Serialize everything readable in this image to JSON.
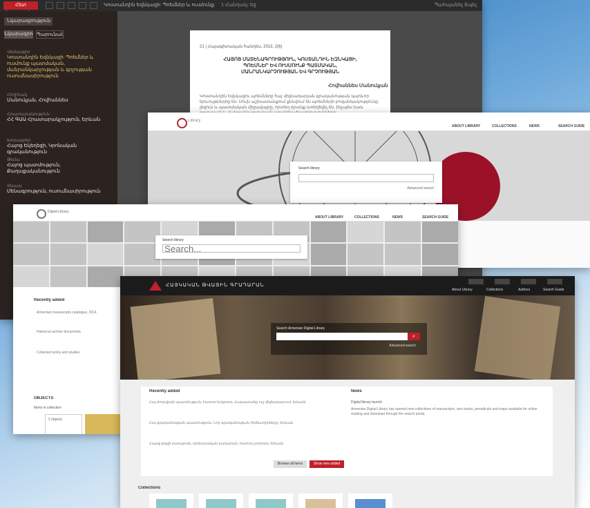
{
  "viewer": {
    "title": "Կոստանդին Եզնկացի: Պոեմներ և ուսմունք պատմական...",
    "back_label": "Հետ վերադառնալ",
    "page_info": "1 Հանդակ: Եջ",
    "toolbar_right": "Պահպանել  Տպել",
    "tabs": [
      "Նկարագրություն",
      "Պարունակություն"
    ],
    "fields": [
      {
        "label": "Վերնագիր",
        "value": "Կոստանդին Եզնկացի: Պոեմներ և ուսմունք պատմական, մանրանկարչության և գրչության ուսումնասիրություն",
        "accent": true
      },
      {
        "label": "Հեղինակ",
        "value": "Մանուկյան, Հովհաննես",
        "accent": false
      },
      {
        "label": "Հրատարակություն",
        "value": "ՀՀ ԳԱԱ Հրատարակչություն, Երևան",
        "accent": false
      },
      {
        "label": "Խորագրեր",
        "value": "Հայոց Եկեղեցի, Կրոնական գրականություն",
        "accent": false
      },
      {
        "label": "Թեմա",
        "value": "Հայոց պատմություն, Քաղաքականություն",
        "accent": false
      },
      {
        "label": "Տեսակ",
        "value": "Մենագրություն, ուսումնասիրություն",
        "accent": false
      }
    ],
    "page_header": "21 | Հայագիտական հանդես, 2013, 2(6)",
    "page_title": "ՀԱՅՈՑ ՄԱՏԵՆԱԳՐՈՒԹՅՈՒՆ, ԿՈՍՏԱՆԴԻՆ ԵԶՆԿԱՑԻ, ՊՈԵՄՆԵՐ ԵՎ ՈՒՍՄՈՒՆՔ ՊԱՏՄԱԿԱՆ, ՄԱՆՐԱՆԿԱՐՉՈՒԹՅԱՆ ԵՎ ԳՐՉՈՒԹՅԱՆ",
    "page_author": "Հովհաննես Մանուկյան",
    "page_body": "Կոստանդին Եզնկացու պոեմները հայ միջնադարյան գրականության կարևոր երևույթներից են: Սույն աշխատանքում քննվում են պոեմների բովանդակությունը, լեզուն և պատմական միջավայրը, որտեղ դրանք ստեղծվել են, ինչպես նաև գրչության և մանրանկարչության առանձնահատկությունները:"
  },
  "library_globe": {
    "logo_text": "Library",
    "nav": [
      "ABOUT LIBRARY",
      "COLLECTIONS",
      "NEWS",
      "SEARCH GUIDE"
    ],
    "search_label": "Search library",
    "advanced": "Advanced search"
  },
  "library_thumbs": {
    "logo_text": "Digital Library",
    "nav": [
      "ABOUT LIBRARY",
      "COLLECTIONS",
      "NEWS",
      "SEARCH GUIDE"
    ],
    "search_label": "Search library",
    "search_placeholder": "Search...",
    "recent_title": "Recently added",
    "items": [
      "Armenian manuscripts catalogue, 2014",
      "Historical archive documents",
      "Collected works and studies"
    ],
    "section2": "OBJECTS",
    "section3": "Items in collection",
    "card_text": "2 objects"
  },
  "digital_library": {
    "logo_text": "ՀԱՅԿԱԿԱՆ ԹՎԱՅԻՆ ԳՐԱԴԱՐԱՆ",
    "nav": [
      "About Library",
      "Collections",
      "Authors",
      "Search Guide"
    ],
    "search_label": "Search Armenian Digital Library",
    "search_button": "⌕",
    "advanced": "Advanced search",
    "recent_title": "Recently added",
    "recent_items": [
      "Հայ ժողովրդի պատմություն, հատոր երկրորդ, Հայաստանը ուշ միջնադարում, Երևան",
      "Հայ գրականության պատմություն, Նոր գրականության հիմնադիրները, Երևան",
      "Հայոց լեզվի բառարան, Արմատական բառարան, հատոր չորրորդ, Երևան"
    ],
    "news_title": "News",
    "news_item_title": "Digital library launch",
    "news_body": "Armenian Digital Library has opened new collections of manuscripts, rare books, periodicals and maps available for online reading and download through the search portal.",
    "btn_more": "Browse all items",
    "btn_all": "Show new added",
    "collections_title": "Collections"
  },
  "colors": {
    "accent": "#c0202a",
    "gold": "#e0c470",
    "dark": "#1b1b1b"
  }
}
